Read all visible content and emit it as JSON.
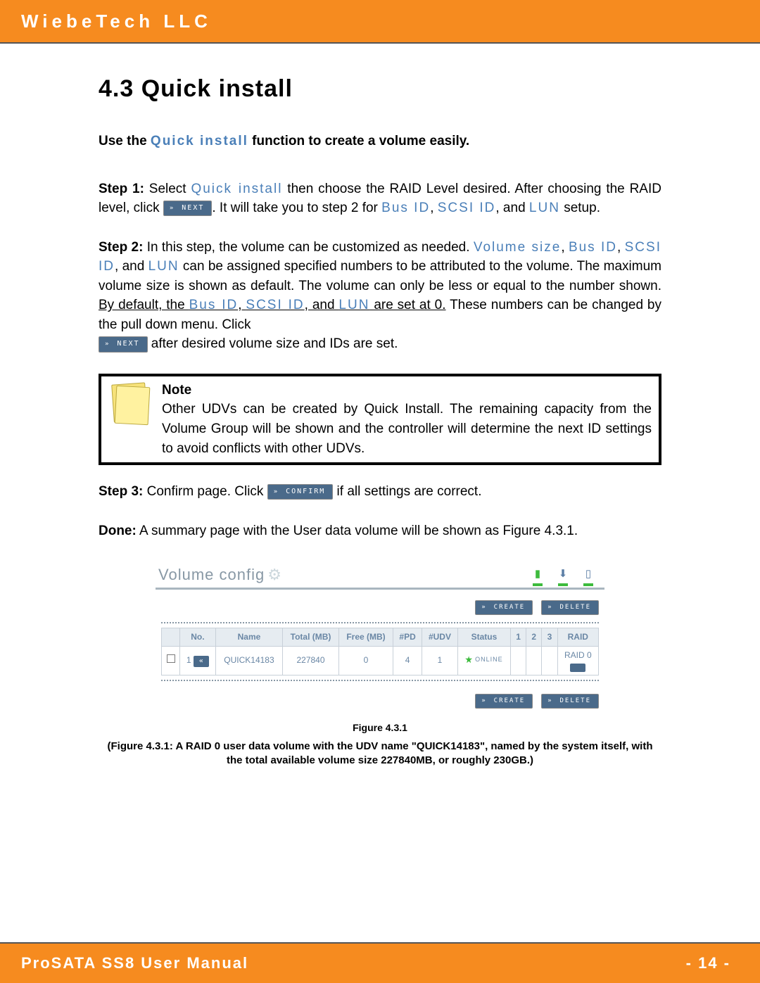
{
  "header": {
    "company": "WiebeTech LLC"
  },
  "footer": {
    "manual": "ProSATA SS8 User Manual",
    "page": "- 14 -"
  },
  "title": "4.3  Quick install",
  "intro": {
    "pre": "Use the ",
    "link": "Quick install",
    "post": " function to create a volume easily."
  },
  "step1": {
    "label": "Step 1:",
    "t1": " Select ",
    "link1": "Quick install",
    "t2": " then choose the RAID Level desired.  After choosing the RAID level, click ",
    "btn": "NEXT",
    "t3": ". It will take you to step 2 for ",
    "busid": "Bus ID",
    "t4": ", ",
    "scsiid": "SCSI ID",
    "t5": ", and ",
    "lun": "LUN",
    "t6": " setup."
  },
  "step2": {
    "label": "Step 2:",
    "t1": " In this step, the volume can be customized as needed. ",
    "vs": "Volume size",
    "t1b": ", ",
    "busid": "Bus ID",
    "t2": ", ",
    "scsiid": "SCSI ID",
    "t3": ", and ",
    "lun": "LUN",
    "t4": " can be assigned specified numbers to be attributed to the volume. The maximum volume size is shown as default.  The volume can only be less or equal to the number shown. ",
    "u1a": "By default, the ",
    "busid2": "Bus ID",
    "u1b": ", ",
    "scsiid2": "SCSI ID",
    "u1c": ", and ",
    "lun2": "LUN",
    "u1d": " are set at 0.",
    "t5": " These numbers can be changed by the pull down menu. Click ",
    "btn": "NEXT",
    "t6": " after desired volume size and IDs are set."
  },
  "note": {
    "title": "Note",
    "body": "Other UDVs can be created by Quick Install. The remaining capacity from the Volume Group will be shown and the controller will determine the next ID settings to avoid conflicts with other UDVs."
  },
  "step3": {
    "label": "Step 3:",
    "t1": " Confirm page. Click ",
    "btn": "CONFIRM",
    "t2": " if all settings are correct."
  },
  "done": {
    "label": "Done:",
    "text": " A summary page with the User data volume will be shown as Figure 4.3.1."
  },
  "vconfig": {
    "title": "Volume config",
    "buttons": {
      "create": "CREATE",
      "delete": "DELETE"
    },
    "headers": [
      "",
      "No.",
      "Name",
      "Total (MB)",
      "Free (MB)",
      "#PD",
      "#UDV",
      "Status",
      "1",
      "2",
      "3",
      "RAID"
    ],
    "row": {
      "no": "1",
      "back": "«",
      "name": "QUICK14183",
      "total": "227840",
      "free": "0",
      "pd": "4",
      "udv": "1",
      "status": "ONLINE",
      "raid": "RAID 0"
    }
  },
  "figure": {
    "label": "Figure 4.3.1",
    "caption": "(Figure 4.3.1: A RAID 0 user data volume with the UDV name \"QUICK14183\", named by the system itself, with the total available volume size 227840MB, or roughly 230GB.)"
  }
}
